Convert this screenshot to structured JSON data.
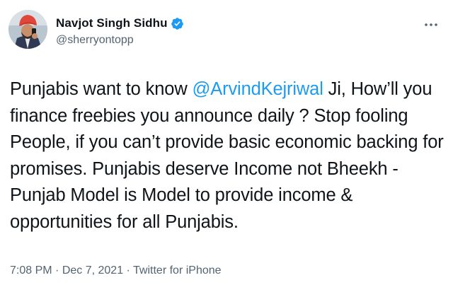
{
  "tweet": {
    "author": {
      "display_name": "Navjot Singh Sidhu",
      "handle": "@sherryontopp",
      "verified_icon": "verified-badge-icon",
      "avatar_icon": "avatar"
    },
    "text": {
      "part1": "Punjabis want to know ",
      "mention": "@ArvindKejriwal",
      "part2": " Ji, How’ll you finance freebies you announce daily ? Stop fooling People, if you can’t provide basic economic backing for promises. Punjabis deserve Income not Bheekh - Punjab Model is Model to provide income & opportunities for all Punjabis."
    },
    "meta": {
      "time": "7:08 PM",
      "separator": " · ",
      "date": "Dec 7, 2021",
      "source": "Twitter for iPhone"
    },
    "more_icon": "more-horizontal-icon"
  },
  "colors": {
    "link": "#1d9bf0",
    "secondary_text": "#536471",
    "primary_text": "#0f1419",
    "verified": "#1d9bf0"
  }
}
